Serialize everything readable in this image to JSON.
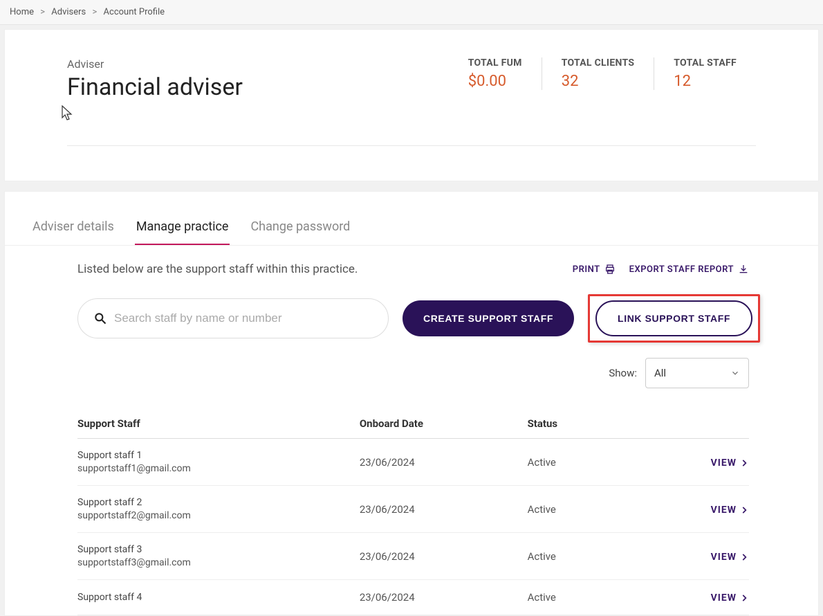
{
  "breadcrumb": {
    "items": [
      "Home",
      "Advisers",
      "Account Profile"
    ]
  },
  "header": {
    "subtitle": "Adviser",
    "title": "Financial adviser",
    "stats": [
      {
        "label": "TOTAL FUM",
        "value": "$0.00"
      },
      {
        "label": "TOTAL CLIENTS",
        "value": "32"
      },
      {
        "label": "TOTAL STAFF",
        "value": "12"
      }
    ]
  },
  "tabs": [
    {
      "label": "Adviser details",
      "active": false
    },
    {
      "label": "Manage practice",
      "active": true
    },
    {
      "label": "Change password",
      "active": false
    }
  ],
  "section": {
    "description": "Listed below are the support staff within this practice.",
    "print_label": "PRINT",
    "export_label": "EXPORT STAFF REPORT",
    "search_placeholder": "Search staff by name or number",
    "create_button": "CREATE SUPPORT STAFF",
    "link_button": "LINK SUPPORT STAFF",
    "filter_label": "Show:",
    "filter_value": "All"
  },
  "table": {
    "headers": [
      "Support Staff",
      "Onboard Date",
      "Status",
      ""
    ],
    "rows": [
      {
        "name": "Support staff 1",
        "email": "supportstaff1@gmail.com",
        "date": "23/06/2024",
        "status": "Active",
        "action": "VIEW"
      },
      {
        "name": "Support staff 2",
        "email": "supportstaff2@gmail.com",
        "date": "23/06/2024",
        "status": "Active",
        "action": "VIEW"
      },
      {
        "name": "Support staff 3",
        "email": "supportstaff3@gmail.com",
        "date": "23/06/2024",
        "status": "Active",
        "action": "VIEW"
      },
      {
        "name": "Support staff 4",
        "email": "",
        "date": "23/06/2024",
        "status": "Active",
        "action": "VIEW"
      }
    ]
  }
}
